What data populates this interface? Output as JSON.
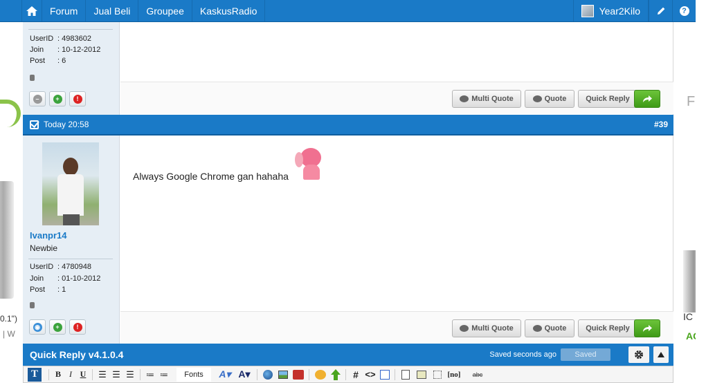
{
  "nav": {
    "items": [
      "Forum",
      "Jual Beli",
      "Groupee",
      "KaskusRadio"
    ],
    "username": "Year2Kilo",
    "help": "?"
  },
  "ads": {
    "left_texts": [
      "0.1\")",
      "| W"
    ],
    "right_texts": [
      "F",
      "IC",
      "AC"
    ]
  },
  "post1": {
    "userid_label": "UserID",
    "userid": ": 4983602",
    "join_label": "Join",
    "join": ": 10-12-2012",
    "post_label": "Post",
    "post": ": 6"
  },
  "post2": {
    "header_time": "Today 20:58",
    "number": "#39",
    "username": "Ivanpr14",
    "rank": "Newbie",
    "userid_label": "UserID",
    "userid": ": 4780948",
    "join_label": "Join",
    "join": ": 01-10-2012",
    "post_label": "Post",
    "post": ": 1",
    "message": "Always Google Chrome gan hahaha"
  },
  "actions": {
    "multi_quote": "Multi Quote",
    "quote": "Quote",
    "quick_reply": "Quick Reply"
  },
  "quick_reply_bar": {
    "title": "Quick Reply  v4.1.0.4",
    "saved_text": "Saved seconds ago",
    "saved_button": "Saved"
  },
  "toolbar": {
    "bold": "B",
    "italic": "I",
    "underline": "U",
    "fonts": "Fonts",
    "hash": "#",
    "code": "<>",
    "noparse": "[no]",
    "strike": "abc"
  },
  "colors": {
    "brand_blue": "#1a7ac7",
    "panel": "#e6eef5",
    "green": "#4aa51e"
  }
}
